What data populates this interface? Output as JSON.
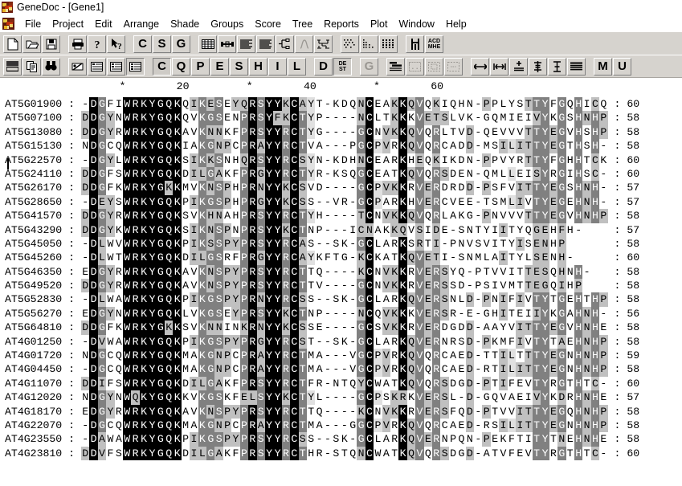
{
  "window": {
    "title": "GeneDoc - [Gene1]",
    "app_icon": "genedoc-icon"
  },
  "menubar": {
    "doc_icon": "document-icon",
    "items": [
      "File",
      "Project",
      "Edit",
      "Arrange",
      "Shade",
      "Groups",
      "Score",
      "Tree",
      "Reports",
      "Plot",
      "Window",
      "Help"
    ]
  },
  "toolbar1": [
    {
      "name": "new-file-button",
      "kind": "icon",
      "icon": "new-document-icon",
      "pressed": false,
      "disabled": false
    },
    {
      "name": "open-file-button",
      "kind": "icon",
      "icon": "open-folder-icon",
      "pressed": false,
      "disabled": false
    },
    {
      "name": "save-file-button",
      "kind": "icon",
      "icon": "save-disk-icon",
      "pressed": false,
      "disabled": false
    },
    {
      "name": "separator",
      "kind": "sep"
    },
    {
      "name": "print-button",
      "kind": "icon",
      "icon": "printer-icon",
      "pressed": false,
      "disabled": false
    },
    {
      "name": "about-button",
      "kind": "icon",
      "icon": "question-mark-icon",
      "pressed": false,
      "disabled": false
    },
    {
      "name": "context-help-button",
      "kind": "icon",
      "icon": "arrow-question-icon",
      "pressed": false,
      "disabled": false
    },
    {
      "name": "separator",
      "kind": "sep"
    },
    {
      "name": "mode-c-button",
      "kind": "text",
      "label": "C",
      "pressed": false,
      "disabled": false
    },
    {
      "name": "mode-s-button",
      "kind": "text",
      "label": "S",
      "pressed": false,
      "disabled": false
    },
    {
      "name": "mode-g-button",
      "kind": "text",
      "label": "G",
      "pressed": false,
      "disabled": false
    },
    {
      "name": "separator",
      "kind": "sep"
    },
    {
      "name": "grid-view-button",
      "kind": "icon",
      "icon": "grid-table-icon",
      "pressed": false,
      "disabled": false
    },
    {
      "name": "link-view-button",
      "kind": "icon",
      "icon": "link-bar-icon",
      "pressed": false,
      "disabled": false
    },
    {
      "name": "list-view-button",
      "kind": "icon",
      "icon": "lines-list-icon",
      "pressed": false,
      "disabled": false
    },
    {
      "name": "align-lines-button",
      "kind": "icon",
      "icon": "lines-block-icon",
      "pressed": false,
      "disabled": false
    },
    {
      "name": "tree-button",
      "kind": "icon",
      "icon": "phylo-tree-icon",
      "pressed": false,
      "disabled": false
    },
    {
      "name": "curve-button",
      "kind": "icon",
      "icon": "curve-plot-icon",
      "pressed": false,
      "disabled": true
    },
    {
      "name": "scatter-button",
      "kind": "icon",
      "icon": "scatter-plot-icon",
      "pressed": false,
      "disabled": false
    },
    {
      "name": "separator",
      "kind": "sep"
    },
    {
      "name": "dot-matrix-button",
      "kind": "icon",
      "icon": "dot-matrix-icon",
      "pressed": false,
      "disabled": false
    },
    {
      "name": "dot-plot-button",
      "kind": "icon",
      "icon": "dot-plot-icon",
      "pressed": false,
      "disabled": false
    },
    {
      "name": "dense-matrix-button",
      "kind": "icon",
      "icon": "dense-matrix-icon",
      "pressed": false,
      "disabled": false
    },
    {
      "name": "separator",
      "kind": "sep"
    },
    {
      "name": "sequence-logo-button",
      "kind": "icon",
      "icon": "bar-marker-icon",
      "pressed": false,
      "disabled": false
    },
    {
      "name": "residue-code-button",
      "kind": "text2",
      "line1": "ACD",
      "line2": "MHE",
      "pressed": false,
      "disabled": false
    }
  ],
  "toolbar2": [
    {
      "name": "page-setup-button",
      "kind": "icon",
      "icon": "page-lines-icon",
      "pressed": false,
      "disabled": false
    },
    {
      "name": "copy-button",
      "kind": "icon",
      "icon": "copy-pages-icon",
      "pressed": false,
      "disabled": false
    },
    {
      "name": "find-button",
      "kind": "icon",
      "icon": "binoculars-icon",
      "pressed": false,
      "disabled": false
    },
    {
      "name": "separator",
      "kind": "sep"
    },
    {
      "name": "shade-off-button",
      "kind": "icon",
      "icon": "no-shade-icon",
      "pressed": false,
      "disabled": false
    },
    {
      "name": "shade-identity-button",
      "kind": "icon",
      "icon": "shade-rows-1-icon",
      "pressed": false,
      "disabled": false
    },
    {
      "name": "shade-similarity-button",
      "kind": "icon",
      "icon": "shade-rows-2-icon",
      "pressed": false,
      "disabled": false
    },
    {
      "name": "shade-conserved-button",
      "kind": "icon",
      "icon": "shade-rows-3-icon",
      "pressed": true,
      "disabled": false
    },
    {
      "name": "separator",
      "kind": "sep"
    },
    {
      "name": "property-c-button",
      "kind": "text",
      "label": "C",
      "pressed": true,
      "disabled": false
    },
    {
      "name": "property-q-button",
      "kind": "text",
      "label": "Q",
      "pressed": false,
      "disabled": false
    },
    {
      "name": "property-p-button",
      "kind": "text",
      "label": "P",
      "pressed": false,
      "disabled": false
    },
    {
      "name": "property-e-button",
      "kind": "text",
      "label": "E",
      "pressed": false,
      "disabled": false
    },
    {
      "name": "property-s-button",
      "kind": "text",
      "label": "S",
      "pressed": false,
      "disabled": false
    },
    {
      "name": "property-h-button",
      "kind": "text",
      "label": "H",
      "pressed": false,
      "disabled": false
    },
    {
      "name": "property-i-button",
      "kind": "text",
      "label": "I",
      "pressed": false,
      "disabled": false
    },
    {
      "name": "property-l-button",
      "kind": "text",
      "label": "L",
      "pressed": false,
      "disabled": false
    },
    {
      "name": "separator",
      "kind": "sep"
    },
    {
      "name": "property-d-button",
      "kind": "text",
      "label": "D",
      "pressed": false,
      "disabled": false
    },
    {
      "name": "property-dest-button",
      "kind": "text2",
      "line1": "DE",
      "line2": "ST",
      "pressed": true,
      "disabled": false
    },
    {
      "name": "separator",
      "kind": "sep"
    },
    {
      "name": "property-g-button",
      "kind": "text",
      "label": "G",
      "pressed": false,
      "disabled": true
    },
    {
      "name": "separator",
      "kind": "sep"
    },
    {
      "name": "align-block-button",
      "kind": "icon",
      "icon": "align-block-icon",
      "pressed": false,
      "disabled": false
    },
    {
      "name": "bracket-button",
      "kind": "icon",
      "icon": "bracket-icon",
      "pressed": false,
      "disabled": true
    },
    {
      "name": "select-region-button",
      "kind": "icon",
      "icon": "dashed-box-icon",
      "pressed": false,
      "disabled": true
    },
    {
      "name": "clear-region-button",
      "kind": "icon",
      "icon": "dashed-box-2-icon",
      "pressed": false,
      "disabled": true
    },
    {
      "name": "separator",
      "kind": "sep"
    },
    {
      "name": "widen-button",
      "kind": "icon",
      "icon": "arrow-horizontal-icon",
      "pressed": false,
      "disabled": false
    },
    {
      "name": "narrow-button",
      "kind": "icon",
      "icon": "arrow-compress-icon",
      "pressed": false,
      "disabled": false
    },
    {
      "name": "raise-button",
      "kind": "icon",
      "icon": "plus-minus-icon",
      "pressed": false,
      "disabled": false
    },
    {
      "name": "spacing-button",
      "kind": "icon",
      "icon": "vertical-spacing-icon",
      "pressed": false,
      "disabled": false
    },
    {
      "name": "line-height-button",
      "kind": "icon",
      "icon": "line-height-icon",
      "pressed": false,
      "disabled": false
    },
    {
      "name": "justify-button",
      "kind": "icon",
      "icon": "justify-lines-icon",
      "pressed": false,
      "disabled": false
    },
    {
      "name": "separator",
      "kind": "sep"
    },
    {
      "name": "mode-m-button",
      "kind": "text",
      "label": "M",
      "pressed": false,
      "disabled": false
    },
    {
      "name": "mode-u-button",
      "kind": "text",
      "label": "U",
      "pressed": false,
      "disabled": false
    }
  ],
  "alignment": {
    "ruler": "                  *        20         *        40         *        60",
    "separator": ":",
    "rows": [
      {
        "name": "AT5G01900",
        "seq": "-DGFIWRKYGQKQIKESEYQRSYYKCAYT-KDQNCEAKKQVQKIQHN-PPLYSTTYFGQHICQ",
        "end": "60"
      },
      {
        "name": "AT5G07100",
        "seq": "DDGYNWRKYGQKQVKGSENPRSYFKCTYP----NCLTKKKVETSLVK-GQMIEIVYKGSHNHP",
        "end": "58"
      },
      {
        "name": "AT5G13080",
        "seq": "DDGYRWRKYGQKAVKNNKFPRSYYRCTYG----GCNVKKQVQRLTVD-QEVVVTTYEGVHSHP",
        "end": "58"
      },
      {
        "name": "AT5G15130",
        "seq": "NDGCQWRKYGQKIAKGNPCPRAYYRCTVA---PGCPVRKQVQRCADD-MSILITTYEGTHSH-",
        "end": "58"
      },
      {
        "name": "AT5G22570",
        "seq": "-DGYLWRKYGQKSIKKSNHQRSYYRCSYN-KDHNCEARKHEQKIKDN-PPVYRTTYFGHHTCK",
        "end": "60"
      },
      {
        "name": "AT5G24110",
        "seq": "DDGFSWRKYGQKDILGAKFPRGYYRCTYR-KSQGCEATKQVQRSDEN-QMLLEISYRGIHSC-",
        "end": "60"
      },
      {
        "name": "AT5G26170",
        "seq": "DDGFKWRKYGKKMVKNSPHPRNYYKCSVD----GCPVKKRVERDRDD-PSFVITTYEGSHNH-",
        "end": "57"
      },
      {
        "name": "AT5G28650",
        "seq": "-DEYSWRKYGQKPIKGSPHPRGYYKCSS--VR-GCPARKHVERCVEE-TSMLIVTYEGEHNH-",
        "end": "57"
      },
      {
        "name": "AT5G41570",
        "seq": "DDGYRWRKYGQKSVKHNAHPRSYYRCTYH----TCNVKKQVQRLAKG-PNVVVTTYEGVHNHP",
        "end": "58"
      },
      {
        "name": "AT5G43290",
        "seq": "DDGYKWRKYGQKSIKNSPNPRSYYKCTNP---ICNAKKQVSIDE-SNTYIITYQGEHFH-",
        "end": "57"
      },
      {
        "name": "AT5G45050",
        "seq": "-DLWVWRKYGQKPIKSSPYPRSYYRCAS--SK-GCLARKSRTI-PNVSVITYISENHP",
        "end": "58"
      },
      {
        "name": "AT5G45260",
        "seq": "-DLWTWRKYGQKDILGSRFPRGYYRCAYKFTG-KCKATKQVETI-SNMLAITYLSENH-",
        "end": "60"
      },
      {
        "name": "AT5G46350",
        "seq": "EDGYRWRKYGQKAVKNSPYPRSYYRCTTQ----KCNVKKRVERSYQ-PTVVITTESQHNH-",
        "end": "58"
      },
      {
        "name": "AT5G49520",
        "seq": "DDGYRWRKYGQKAVKNSPYPRSYYRCTTV----GCNVKKRVERSSD-PSIVMTTEGQIHP",
        "end": "58"
      },
      {
        "name": "AT5G52830",
        "seq": "-DLWAWRKYGQKPIKGSPYPRNYYRCSS--SK-GCLARKQVERSNLD-PNIFIVTYTGEHTHP",
        "end": "58"
      },
      {
        "name": "AT5G56270",
        "seq": "EDGYNWRKYGQKLVKGSEYPRSYYKCTNP----NCQVKKKVERSR-E-GHITEIIYKGAHNH-",
        "end": "56"
      },
      {
        "name": "AT5G64810",
        "seq": "DDGFKWRKYGKKSVKNNINKRNYYKCSSE----GCSVKKRVERDGDD-AAYVITTYEGVHNHE",
        "end": "58"
      },
      {
        "name": "AT4G01250",
        "seq": "-DVWAWRKYGQKPIKGSPYPRGYYRCST--SK-GCLARKQVERNRSD-PKMFIVTYTAEHNHP",
        "end": "58"
      },
      {
        "name": "AT4G01720",
        "seq": "NDGCQWRKYGQKMAKGNPCPRAYYRCTMA---VGCPVRKQVQRCAED-TTILTTTYEGNHNHP",
        "end": "59"
      },
      {
        "name": "AT4G04450",
        "seq": "-DGCQWRKYGQKMAKGNPCPRAYYRCTMA---VGCPVRKQVQRCAED-RTILITTYEGNHNHP",
        "end": "58"
      },
      {
        "name": "AT4G11070",
        "seq": "DDIFSWRKYGQKDILGAKFPRSYYRCTFR-NTQYCWATKQVQRSDGD-PTIFEVTYRGTHTC-",
        "end": "60"
      },
      {
        "name": "AT4G12020",
        "seq": "NDGYNWQKYGQKKVKGSKFELSYYKCTYL----GCPSKRKVERSL-D-GQVAEIVYKDRHNHE",
        "end": "57"
      },
      {
        "name": "AT4G18170",
        "seq": "EDGYRWRKYGQKAVKNSPYPRSYYRCTTQ----KCNVKKRVERSFQD-PTVVITTYEGQHNHP",
        "end": "58"
      },
      {
        "name": "AT4G22070",
        "seq": "-DGCQWRKYGQKMAKGNPCPRAYYRCTMA---GGCPVRKQVQRCAED-RSILITTYEGNHNHP",
        "end": "58"
      },
      {
        "name": "AT4G23550",
        "seq": "-DAWAWRKYGQKPIKGSPYPRSYYRCSS--SK-GCLARKQVERNPQN-PEKFTITYTNEHNHE",
        "end": "58"
      },
      {
        "name": "AT4G23810",
        "seq": "DDVFSWRKYGQKDILGAKFPRSYYRCTHR-STQNCWATKQVQRSDGD-ATVFEVTYRGTHTC-",
        "end": "60"
      }
    ]
  }
}
